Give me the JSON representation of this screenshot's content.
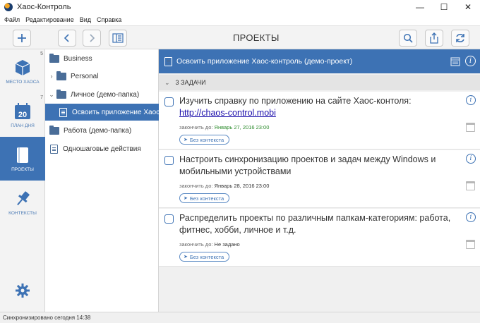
{
  "window": {
    "title": "Хаос-Контроль"
  },
  "menu": [
    "Файл",
    "Редактирование",
    "Вид",
    "Справка"
  ],
  "toolbar": {
    "page_title": "ПРОЕКТЫ"
  },
  "nav": [
    {
      "label": "МЕСТО ХАОСА",
      "badge": "5",
      "icon": "cube-icon"
    },
    {
      "label": "ПЛАН ДНЯ",
      "badge": "7",
      "icon": "calendar-icon",
      "day": "20"
    },
    {
      "label": "ПРОЕКТЫ",
      "badge": "",
      "icon": "notebook-icon",
      "active": true
    },
    {
      "label": "КОНТЕКСТЫ",
      "badge": "",
      "icon": "pin-icon"
    }
  ],
  "folders": [
    {
      "label": "Business",
      "type": "folder"
    },
    {
      "label": "Personal",
      "type": "folder"
    },
    {
      "label": "Личное (демо-папка)",
      "type": "folder"
    },
    {
      "label": "Освоить приложение Хаос-контроль (демо-проект)",
      "type": "project",
      "selected": true
    },
    {
      "label": "Работа (демо-папка)",
      "type": "folder"
    },
    {
      "label": "Одношаговые действия",
      "type": "project"
    }
  ],
  "project": {
    "title": "Освоить приложение Хаос-контроль (демо-проект)",
    "group_label": "3 ЗАДАЧИ"
  },
  "tasks": [
    {
      "text": "Изучить справку по приложению на сайте Хаос-контоля: ",
      "link": "http://chaos-control.mobi",
      "due_label": "закончить до:",
      "due_value": "Январь 27, 2016 23:00",
      "context": "Без контекста"
    },
    {
      "text": "Настроить синхронизацию проектов и задач между Windows и мобильными устройствами",
      "due_label": "закончить до:",
      "due_value": "Январь 28, 2016 23:00",
      "context": "Без контекста"
    },
    {
      "text": "Распределить проекты по различным папкам-категориям: работа, фитнес, хобби, личное и т.д.",
      "due_label": "закончить до:",
      "due_value": "Не задано",
      "context": "Без контекста"
    }
  ],
  "status": {
    "text": "Синхронизировано сегодня 14:38"
  },
  "colors": {
    "accent": "#3d72b4",
    "due_green": "#2a8a2a"
  }
}
